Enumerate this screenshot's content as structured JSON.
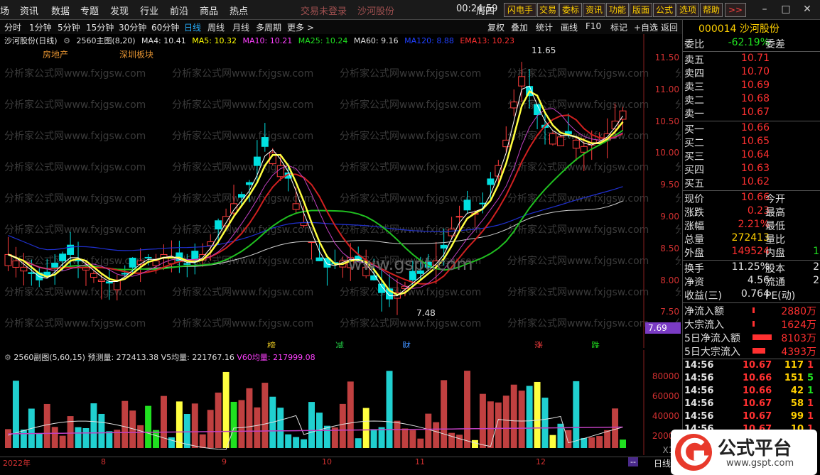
{
  "menu": {
    "items": [
      "场",
      "资讯",
      "数据",
      "专题",
      "发现",
      "行业",
      "前沿",
      "商品",
      "热点"
    ],
    "login_status": "交易未登录",
    "stock_name": "沙河股份",
    "time": "00:24:59",
    "weekday": "周四",
    "toolbar": [
      "闪电手",
      "交易",
      "委标",
      "资讯",
      "功能",
      "版面",
      "公式",
      "选项",
      "帮助"
    ],
    "more": ">>"
  },
  "periods": {
    "items": [
      "分时",
      "1分钟",
      "5分钟",
      "15分钟",
      "30分钟",
      "60分钟",
      "日线",
      "周线",
      "月线",
      "多周期",
      "更多 >"
    ],
    "active_index": 6,
    "right_tools": [
      "复权",
      "叠加",
      "统计",
      "画线",
      "F10",
      "标记",
      "+自选",
      "返回"
    ]
  },
  "main_chart": {
    "title": "沙河股份(日线)",
    "indicator_name": "2560主图(8,20)",
    "ma": [
      {
        "label": "MA4: 10.41",
        "color": "#e0e0e0"
      },
      {
        "label": "MA5: 10.32",
        "color": "#ffff00"
      },
      {
        "label": "MA10: 10.21",
        "color": "#ff40ff"
      },
      {
        "label": "MA25: 10.24",
        "color": "#20e020"
      },
      {
        "label": "MA60: 9.16",
        "color": "#e0e0e0"
      },
      {
        "label": "MA120: 8.88",
        "color": "#2040ff"
      },
      {
        "label": "EMA13: 10.23",
        "color": "#ff3030"
      }
    ],
    "tags": [
      "房地产",
      "深圳板块"
    ],
    "watermark": "www.gspt.com",
    "wm_text": "分析家公式网www.fxjgsw.com",
    "high_label": "11.65",
    "low_label": "7.48",
    "current_price": "7.69",
    "y_ticks": [
      "11.50",
      "11.00",
      "10.50",
      "10.00",
      "9.50",
      "9.00",
      "8.50",
      "8.00",
      "7.50"
    ],
    "markers": [
      "榜",
      "减",
      "财",
      "涨",
      "跌"
    ],
    "marker_colors": [
      "#e0c020",
      "#20c040",
      "#4090ff",
      "#ff4040",
      "#20e020"
    ]
  },
  "sub_chart": {
    "name": "2560副图(5,60,15)",
    "forecast": "预测量: 272413.38",
    "v5": "V5均量: 221767.16",
    "v60": "V60均量: 217999.08",
    "y_ticks": [
      "80000",
      "60000",
      "40000",
      "20000"
    ],
    "unit": "X10"
  },
  "x_axis": {
    "labels": [
      "2022年",
      "8",
      "9",
      "10",
      "11",
      "12",
      "--"
    ],
    "mode": "日线"
  },
  "quote": {
    "code": "000014",
    "name": "沙河股份",
    "weibi_label": "委比",
    "weibi_value": "-62.19%",
    "weicha_label": "委差",
    "sell": [
      {
        "label": "卖五",
        "price": "10.71"
      },
      {
        "label": "卖四",
        "price": "10.70"
      },
      {
        "label": "卖三",
        "price": "10.69"
      },
      {
        "label": "卖二",
        "price": "10.68"
      },
      {
        "label": "卖一",
        "price": "10.67"
      }
    ],
    "buy": [
      {
        "label": "买一",
        "price": "10.66"
      },
      {
        "label": "买二",
        "price": "10.65"
      },
      {
        "label": "买三",
        "price": "10.64"
      },
      {
        "label": "买四",
        "price": "10.63"
      },
      {
        "label": "买五",
        "price": "10.62"
      }
    ],
    "stats": [
      {
        "label": "现价",
        "value": "10.66",
        "label2": "今开"
      },
      {
        "label": "涨跌",
        "value": "0.23",
        "label2": "最高"
      },
      {
        "label": "涨幅",
        "value": "2.21%",
        "label2": "最低"
      },
      {
        "label": "总量",
        "value": "272413",
        "label2": "量比"
      },
      {
        "label": "外盘",
        "value": "149524",
        "label2": "内盘",
        "value2": "1"
      }
    ],
    "stats2": [
      {
        "label": "换手",
        "value": "11.25%",
        "label2": "股本",
        "value2": "2"
      },
      {
        "label": "净资",
        "value": "4.56",
        "label2": "流通",
        "value2": "2"
      },
      {
        "label": "收益(三)",
        "value": "0.764",
        "label2": "PE(动)"
      }
    ],
    "flows": [
      {
        "label": "净流入额",
        "value": "2880万",
        "bar": 0.1
      },
      {
        "label": "大宗流入",
        "value": "1624万",
        "bar": 0.1
      },
      {
        "label": "5日净流入额",
        "value": "8103万",
        "bar": 0.9
      },
      {
        "label": "5日大宗流入",
        "value": "4393万",
        "bar": 0.6
      }
    ],
    "ticks": [
      {
        "time": "14:56",
        "price": "10.67",
        "vol": "117",
        "dir": "1"
      },
      {
        "time": "14:56",
        "price": "10.66",
        "vol": "151",
        "dir": "5"
      },
      {
        "time": "14:56",
        "price": "10.66",
        "vol": "42",
        "dir": "1"
      },
      {
        "time": "14:56",
        "price": "10.67",
        "vol": "58",
        "dir": "1"
      },
      {
        "time": "14:56",
        "price": "10.67",
        "vol": "99",
        "dir": "1"
      },
      {
        "time": "14:56",
        "price": "10.67",
        "vol": "10",
        "dir": "1"
      }
    ]
  },
  "logo": {
    "text": "公式平台",
    "url": "www.gspt.com"
  }
}
